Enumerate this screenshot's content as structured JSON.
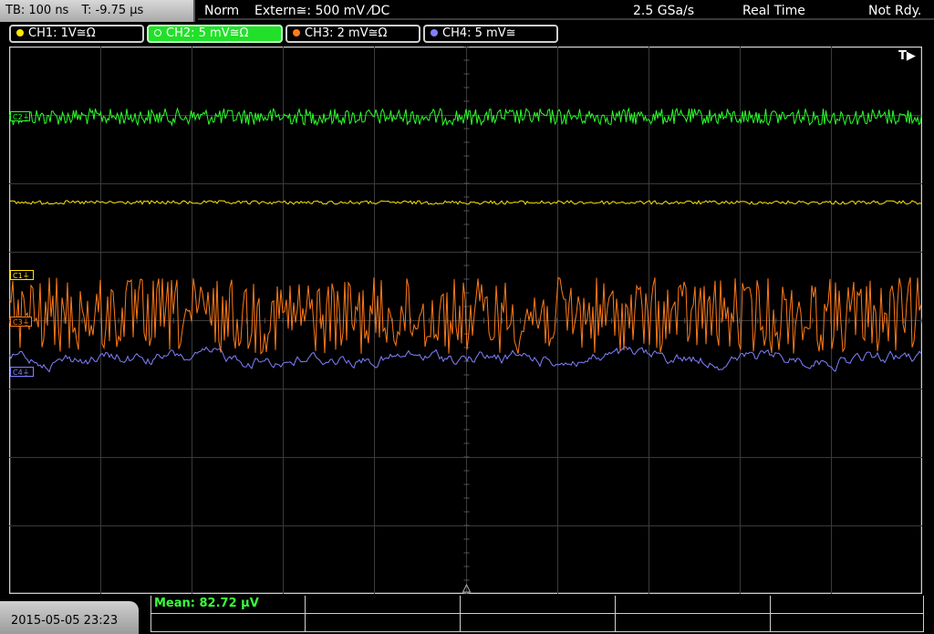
{
  "status_bar": {
    "timebase": "TB: 100 ns",
    "trigger_time": "T: -9.75 µs",
    "trigger_mode": "Norm",
    "trigger_source": "Extern≅: 500 mV ⁄DC",
    "sample_rate": "2.5 GSa/s",
    "acquisition_mode": "Real Time",
    "acquisition_state": "Not Rdy."
  },
  "channels": [
    {
      "label": "CH1: 1V≅Ω",
      "color": "#ffe600",
      "active": false
    },
    {
      "label": "CH2: 5 mV≅Ω",
      "color": "#2aff2a",
      "active": true
    },
    {
      "label": "CH3: 2 mV≅Ω",
      "color": "#ff7a18",
      "active": false
    },
    {
      "label": "CH4: 5 mV≅",
      "color": "#8080ff",
      "active": false
    }
  ],
  "screen": {
    "trigger_indicator": "T▶",
    "markers": {
      "c1": "C1⏚",
      "c3": "C3⏚",
      "c4": "C4⏚",
      "c2": "C2⏚"
    }
  },
  "footer": {
    "datetime": "2015-05-05 23:23",
    "measurement": "Mean: 82.72 µV"
  }
}
